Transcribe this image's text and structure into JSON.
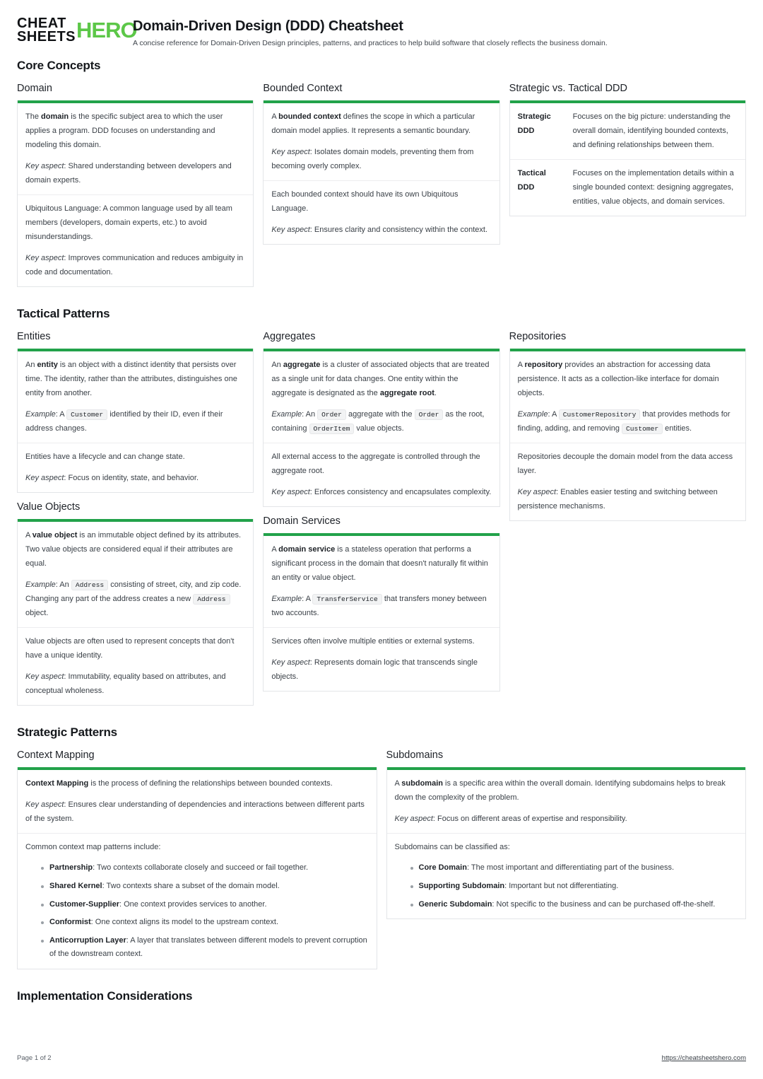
{
  "brand": {
    "line1": "CHEAT",
    "line2": "SHEETS",
    "accent": "HERO",
    "accent_color": "#5cc748"
  },
  "header": {
    "title": "Domain-Driven Design (DDD) Cheatsheet",
    "subtitle": "A concise reference for Domain-Driven Design principles, patterns, and practices to help build software that closely reflects the business domain."
  },
  "theme": {
    "accent_bar": "#22a24a",
    "card_border": "#e3e5e8"
  },
  "sections": {
    "core": {
      "title": "Core Concepts"
    },
    "tactical": {
      "title": "Tactical Patterns"
    },
    "strategic": {
      "title": "Strategic Patterns"
    },
    "implementation": {
      "title": "Implementation Considerations"
    }
  },
  "cards": {
    "domain": {
      "title": "Domain",
      "seg1_p1_pre": "The ",
      "seg1_p1_bold": "domain",
      "seg1_p1_post": " is the specific subject area to which the user applies a program. DDD focuses on understanding and modeling this domain.",
      "seg1_p2_em": "Key aspect",
      "seg1_p2_post": ": Shared understanding between developers and domain experts.",
      "seg2_p1": "Ubiquitous Language: A common language used by all team members (developers, domain experts, etc.) to avoid misunderstandings.",
      "seg2_p2_em": "Key aspect",
      "seg2_p2_post": ": Improves communication and reduces ambiguity in code and documentation."
    },
    "bounded_context": {
      "title": "Bounded Context",
      "seg1_p1_pre": "A ",
      "seg1_p1_bold": "bounded context",
      "seg1_p1_post": " defines the scope in which a particular domain model applies. It represents a semantic boundary.",
      "seg1_p2_em": "Key aspect",
      "seg1_p2_post": ": Isolates domain models, preventing them from becoming overly complex.",
      "seg2_p1": "Each bounded context should have its own Ubiquitous Language.",
      "seg2_p2_em": "Key aspect",
      "seg2_p2_post": ": Ensures clarity and consistency within the context."
    },
    "strategic_vs_tactical": {
      "title": "Strategic vs. Tactical DDD",
      "rows": [
        {
          "term": "Strategic DDD",
          "desc": "Focuses on the big picture: understanding the overall domain, identifying bounded contexts, and defining relationships between them."
        },
        {
          "term": "Tactical DDD",
          "desc": "Focuses on the implementation details within a single bounded context: designing aggregates, entities, value objects, and domain services."
        }
      ]
    },
    "entities": {
      "title": "Entities",
      "seg1_p1_pre": "An ",
      "seg1_p1_bold": "entity",
      "seg1_p1_post": " is an object with a distinct identity that persists over time. The identity, rather than the attributes, distinguishes one entity from another.",
      "seg1_p2_em": "Example",
      "seg1_p2_mid": ": A ",
      "seg1_p2_code": "Customer",
      "seg1_p2_post": " identified by their ID, even if their address changes.",
      "seg2_p1": "Entities have a lifecycle and can change state.",
      "seg2_p2_em": "Key aspect",
      "seg2_p2_post": ": Focus on identity, state, and behavior."
    },
    "aggregates": {
      "title": "Aggregates",
      "seg1_p1_pre": "An ",
      "seg1_p1_bold": "aggregate",
      "seg1_p1_mid": " is a cluster of associated objects that are treated as a single unit for data changes. One entity within the aggregate is designated as the ",
      "seg1_p1_bold2": "aggregate root",
      "seg1_p1_post": ".",
      "seg1_p2_em": "Example",
      "seg1_p2_a": ": An ",
      "seg1_p2_code1": "Order",
      "seg1_p2_b": " aggregate with the ",
      "seg1_p2_code2": "Order",
      "seg1_p2_c": " as the root, containing ",
      "seg1_p2_code3": "OrderItem",
      "seg1_p2_d": " value objects.",
      "seg2_p1": "All external access to the aggregate is controlled through the aggregate root.",
      "seg2_p2_em": "Key aspect",
      "seg2_p2_post": ": Enforces consistency and encapsulates complexity."
    },
    "repositories": {
      "title": "Repositories",
      "seg1_p1_pre": "A ",
      "seg1_p1_bold": "repository",
      "seg1_p1_post": " provides an abstraction for accessing data persistence. It acts as a collection-like interface for domain objects.",
      "seg1_p2_em": "Example",
      "seg1_p2_a": ": A ",
      "seg1_p2_code1": "CustomerRepository",
      "seg1_p2_b": " that provides methods for finding, adding, and removing ",
      "seg1_p2_code2": "Customer",
      "seg1_p2_c": " entities.",
      "seg2_p1": "Repositories decouple the domain model from the data access layer.",
      "seg2_p2_em": "Key aspect",
      "seg2_p2_post": ": Enables easier testing and switching between persistence mechanisms."
    },
    "value_objects": {
      "title": "Value Objects",
      "seg1_p1_pre": "A ",
      "seg1_p1_bold": "value object",
      "seg1_p1_post": " is an immutable object defined by its attributes. Two value objects are considered equal if their attributes are equal.",
      "seg1_p2_em": "Example",
      "seg1_p2_a": ": An ",
      "seg1_p2_code1": "Address",
      "seg1_p2_b": " consisting of street, city, and zip code. Changing any part of the address creates a new ",
      "seg1_p2_code2": "Address",
      "seg1_p2_c": " object.",
      "seg2_p1": "Value objects are often used to represent concepts that don't have a unique identity.",
      "seg2_p2_em": "Key aspect",
      "seg2_p2_post": ": Immutability, equality based on attributes, and conceptual wholeness."
    },
    "domain_services": {
      "title": "Domain Services",
      "seg1_p1_pre": "A ",
      "seg1_p1_bold": "domain service",
      "seg1_p1_post": " is a stateless operation that performs a significant process in the domain that doesn't naturally fit within an entity or value object.",
      "seg1_p2_em": "Example",
      "seg1_p2_a": ": A ",
      "seg1_p2_code1": "TransferService",
      "seg1_p2_b": " that transfers money between two accounts.",
      "seg2_p1": "Services often involve multiple entities or external systems.",
      "seg2_p2_em": "Key aspect",
      "seg2_p2_post": ": Represents domain logic that transcends single objects."
    },
    "context_mapping": {
      "title": "Context Mapping",
      "seg1_p1_bold": "Context Mapping",
      "seg1_p1_post": " is the process of defining the relationships between bounded contexts.",
      "seg1_p2_em": "Key aspect",
      "seg1_p2_post": ": Ensures clear understanding of dependencies and interactions between different parts of the system.",
      "seg2_intro": "Common context map patterns include:",
      "bullets": [
        {
          "term": "Partnership",
          "desc": ": Two contexts collaborate closely and succeed or fail together."
        },
        {
          "term": "Shared Kernel",
          "desc": ": Two contexts share a subset of the domain model."
        },
        {
          "term": "Customer-Supplier",
          "desc": ": One context provides services to another."
        },
        {
          "term": "Conformist",
          "desc": ": One context aligns its model to the upstream context."
        },
        {
          "term": "Anticorruption Layer",
          "desc": ": A layer that translates between different models to prevent corruption of the downstream context."
        }
      ]
    },
    "subdomains": {
      "title": "Subdomains",
      "seg1_p1_pre": "A ",
      "seg1_p1_bold": "subdomain",
      "seg1_p1_post": " is a specific area within the overall domain. Identifying subdomains helps to break down the complexity of the problem.",
      "seg1_p2_em": "Key aspect",
      "seg1_p2_post": ": Focus on different areas of expertise and responsibility.",
      "seg2_intro": "Subdomains can be classified as:",
      "bullets": [
        {
          "term": "Core Domain",
          "desc": ": The most important and differentiating part of the business."
        },
        {
          "term": "Supporting Subdomain",
          "desc": ": Important but not differentiating."
        },
        {
          "term": "Generic Subdomain",
          "desc": ": Not specific to the business and can be purchased off-the-shelf."
        }
      ]
    }
  },
  "footer": {
    "page": "Page 1 of 2",
    "url": "https://cheatsheetshero.com"
  }
}
